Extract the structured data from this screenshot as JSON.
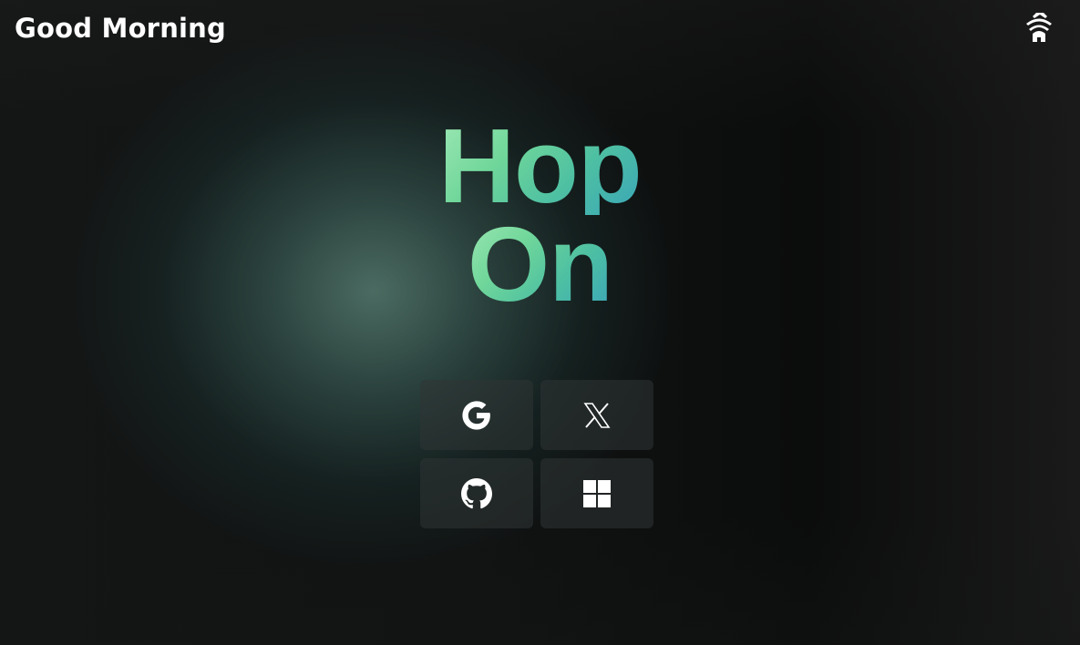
{
  "header": {
    "greeting": "Good Morning",
    "logo_icon": "hopon-logo-icon"
  },
  "hero": {
    "title_line1": "Hop",
    "title_line2": "On",
    "gradient_start": "#9ee8b4",
    "gradient_end": "#3aa6b8"
  },
  "shortcuts": [
    {
      "name": "Google",
      "icon": "google-icon"
    },
    {
      "name": "X",
      "icon": "x-icon"
    },
    {
      "name": "GitHub",
      "icon": "github-icon"
    },
    {
      "name": "Windows",
      "icon": "windows-icon"
    }
  ],
  "colors": {
    "tile_bg": "#2a2e2f",
    "text": "#ffffff"
  }
}
